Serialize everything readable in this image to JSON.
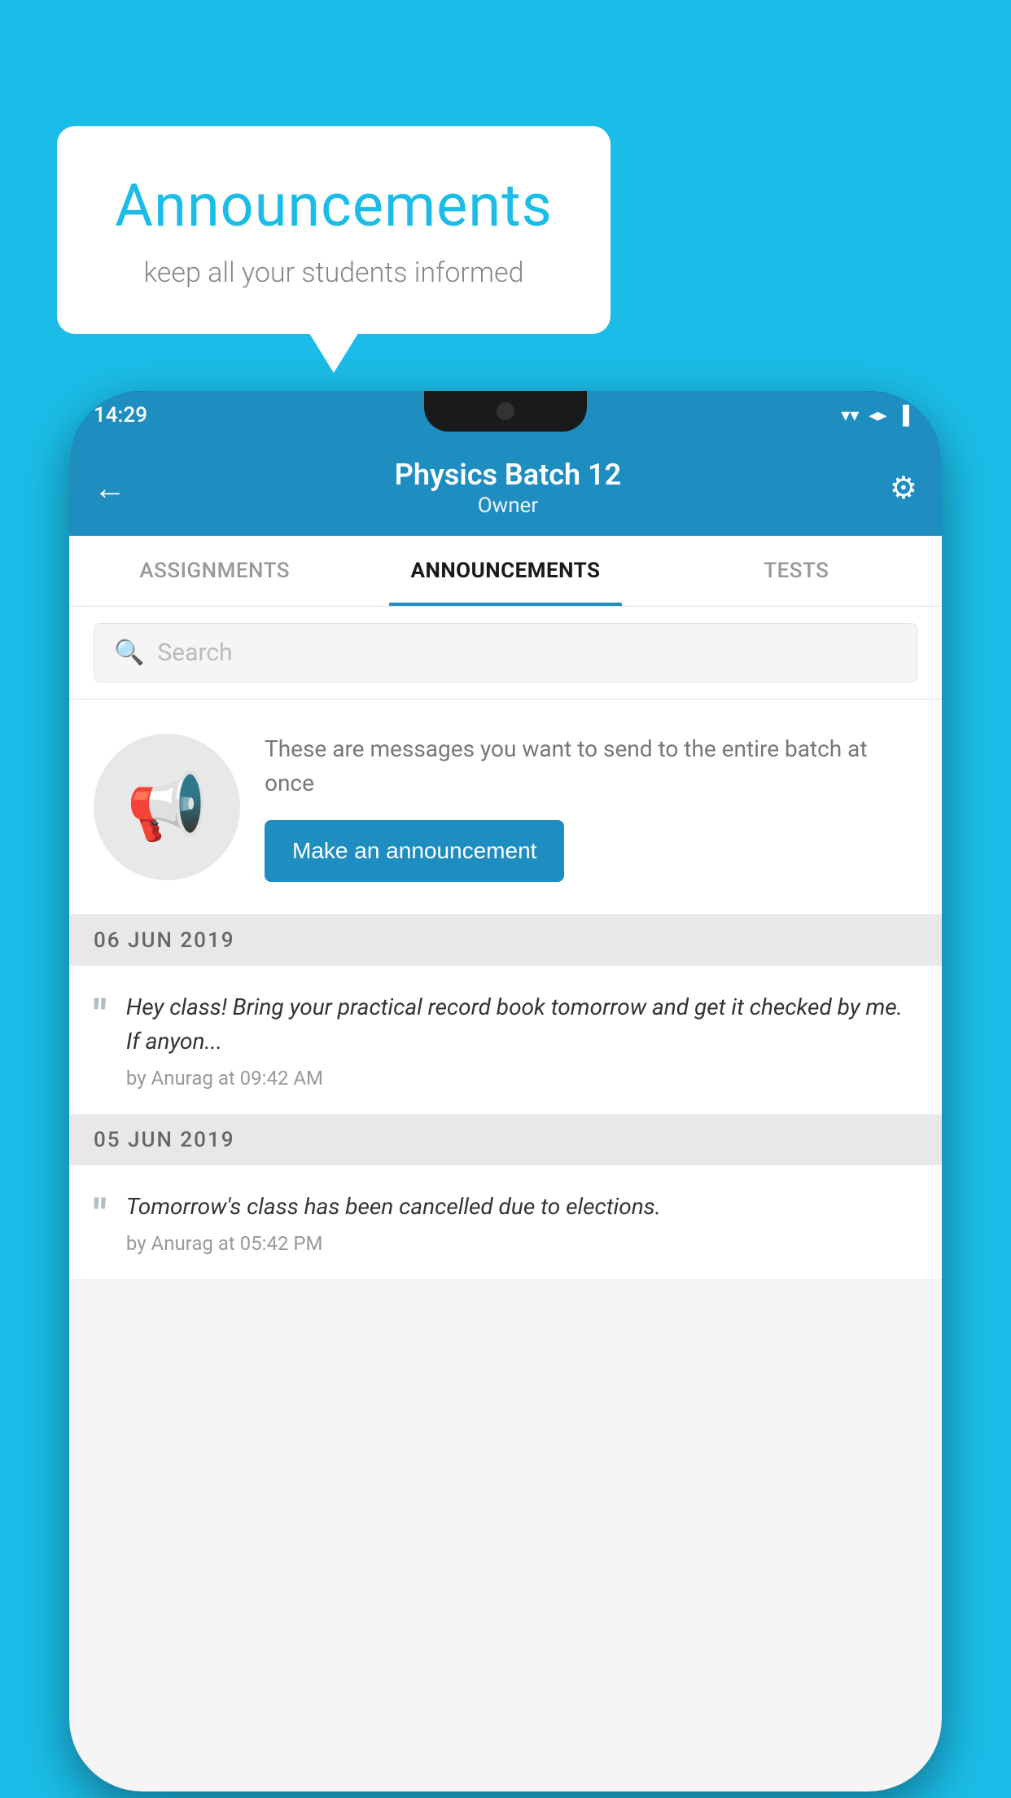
{
  "background_color": "#1BBDE8",
  "speech_bubble": {
    "title": "Announcements",
    "subtitle": "keep all your students informed"
  },
  "phone": {
    "status_bar": {
      "time": "14:29",
      "wifi": "▼",
      "signal": "▲",
      "battery": "▌"
    },
    "header": {
      "back_label": "←",
      "title": "Physics Batch 12",
      "subtitle": "Owner",
      "gear_label": "⚙"
    },
    "tabs": [
      {
        "label": "ASSIGNMENTS",
        "active": false
      },
      {
        "label": "ANNOUNCEMENTS",
        "active": true
      },
      {
        "label": "TESTS",
        "active": false
      }
    ],
    "search": {
      "placeholder": "Search"
    },
    "cta": {
      "description": "These are messages you want to send to the entire batch at once",
      "button_label": "Make an announcement"
    },
    "announcements": [
      {
        "date": "06  JUN  2019",
        "text": "Hey class! Bring your practical record book tomorrow and get it checked by me. If anyon...",
        "meta": "by Anurag at 09:42 AM"
      },
      {
        "date": "05  JUN  2019",
        "text": "Tomorrow's class has been cancelled due to elections.",
        "meta": "by Anurag at 05:42 PM"
      }
    ]
  }
}
